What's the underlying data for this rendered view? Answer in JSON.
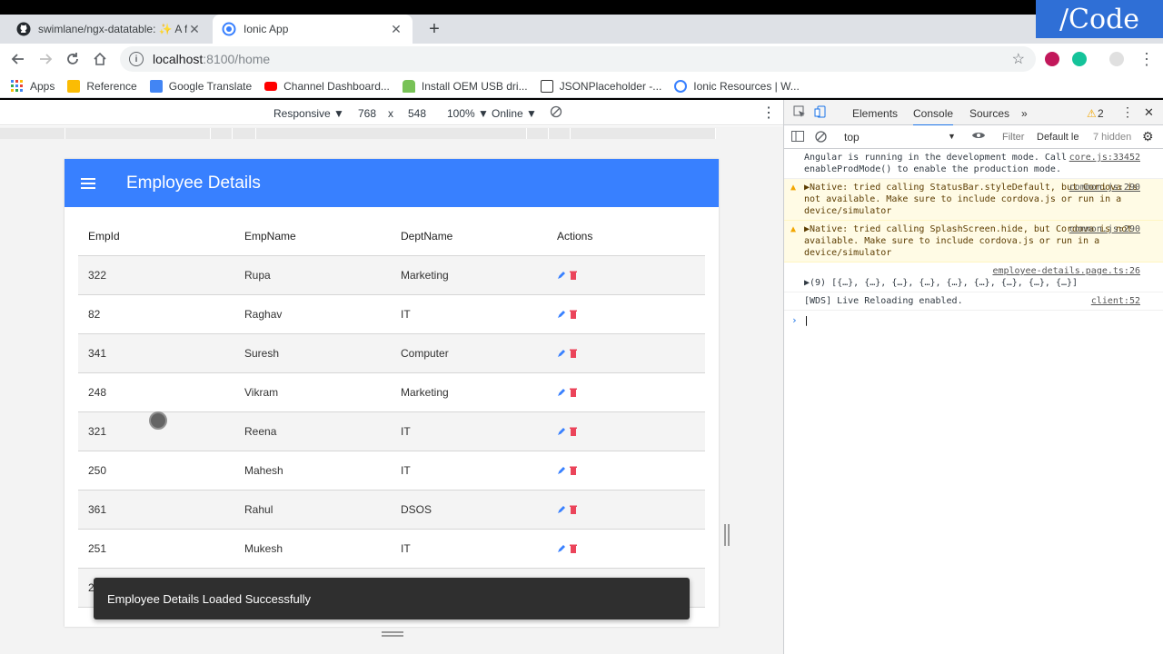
{
  "browser": {
    "tabs": [
      {
        "title": "swimlane/ngx-datatable: ✨ A feature-rich yet lightweight",
        "active": false,
        "icon": "github-icon"
      },
      {
        "title": "Ionic App",
        "active": true,
        "icon": "ionic-icon"
      }
    ],
    "url_host": "localhost",
    "url_path": ":8100/home",
    "brand": "/Code"
  },
  "bookmarks": [
    {
      "label": "Apps",
      "icon": "apps-grid-icon",
      "color": "#4285f4"
    },
    {
      "label": "Reference",
      "icon": "folder-icon",
      "color": "#fbbc04"
    },
    {
      "label": "Google Translate",
      "icon": "translate-icon",
      "color": "#4285f4"
    },
    {
      "label": "Channel Dashboard...",
      "icon": "youtube-icon",
      "color": "#ff0000"
    },
    {
      "label": "Install OEM USB dri...",
      "icon": "android-icon",
      "color": "#78c257"
    },
    {
      "label": "JSONPlaceholder -...",
      "icon": "json-icon",
      "color": "#333333"
    },
    {
      "label": "Ionic Resources | W...",
      "icon": "ionic-icon",
      "color": "#3880ff"
    }
  ],
  "devicebar": {
    "mode": "Responsive ▼",
    "width": "768",
    "times": "x",
    "height": "548",
    "zoom": "100% ▼",
    "network": "Online ▼"
  },
  "app": {
    "title": "Employee Details",
    "header_color": "#3880ff",
    "columns": [
      "EmpId",
      "EmpName",
      "DeptName",
      "Actions"
    ],
    "rows": [
      {
        "id": "322",
        "name": "Rupa",
        "dept": "Marketing"
      },
      {
        "id": "82",
        "name": "Raghav",
        "dept": "IT"
      },
      {
        "id": "341",
        "name": "Suresh",
        "dept": "Computer"
      },
      {
        "id": "248",
        "name": "Vikram",
        "dept": "Marketing"
      },
      {
        "id": "321",
        "name": "Reena",
        "dept": "IT"
      },
      {
        "id": "250",
        "name": "Mahesh",
        "dept": "IT"
      },
      {
        "id": "361",
        "name": "Rahul",
        "dept": "DSOS"
      },
      {
        "id": "251",
        "name": "Mukesh",
        "dept": "IT"
      },
      {
        "id": "2",
        "name": "",
        "dept": ""
      }
    ],
    "toast": "Employee Details Loaded Successfully"
  },
  "devtools": {
    "tabs": [
      "Elements",
      "Console",
      "Sources",
      "»"
    ],
    "active_tab": "Console",
    "warnings_count": "2",
    "context": "top",
    "filter_placeholder": "Filter",
    "levels": "Default le",
    "hidden": "7 hidden",
    "messages": [
      {
        "type": "log",
        "text": "Angular is running in the development mode. Call enableProdMode() to enable the production mode.",
        "source": "core.js:33452"
      },
      {
        "type": "warn",
        "text": "▶Native: tried calling StatusBar.styleDefault, but Cordova is not available. Make sure to include cordova.js or run in a device/simulator",
        "source": "common.js:290"
      },
      {
        "type": "warn",
        "text": "▶Native: tried calling SplashScreen.hide, but Cordova is not available. Make sure to include cordova.js or run in a device/simulator",
        "source": "common.js:290"
      },
      {
        "type": "log",
        "text": "▶(9) [{…}, {…}, {…}, {…}, {…}, {…}, {…}, {…}, {…}]",
        "source": "employee-details.page.ts:26"
      },
      {
        "type": "log",
        "text": "[WDS] Live Reloading enabled.",
        "source": "client:52"
      }
    ],
    "prompt": "›"
  }
}
